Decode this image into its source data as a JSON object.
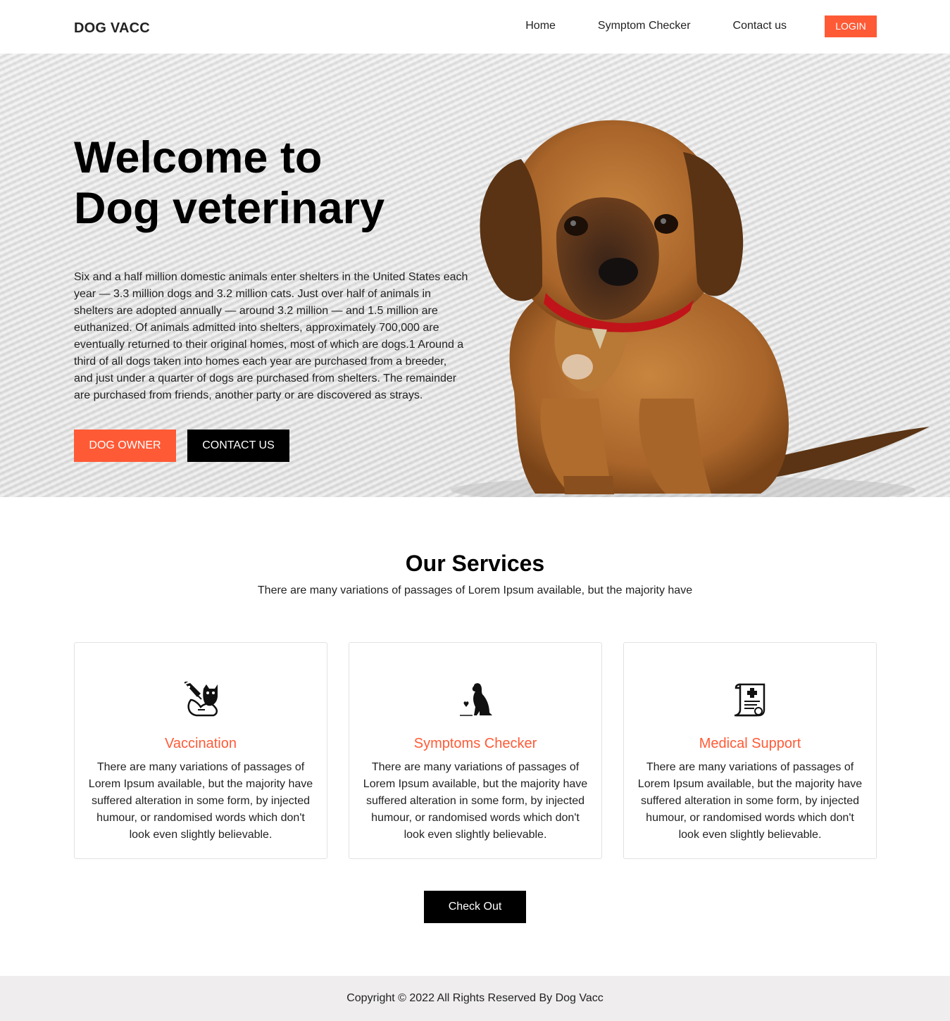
{
  "header": {
    "brand": "DOG VACC",
    "nav": [
      "Home",
      "Symptom Checker",
      "Contact us"
    ],
    "login_label": "LOGIN"
  },
  "hero": {
    "title_line1": "Welcome to",
    "title_line2": "Dog veterinary",
    "text": "Six and a half million domestic animals enter shelters in the United States each year — 3.3 million dogs and 3.2 million cats. Just over half of animals in shelters are adopted annually — around 3.2 million — and 1.5 million are euthanized. Of animals admitted into shelters, approximately 700,000 are eventually returned to their original homes, most of which are dogs.1 Around a third of all dogs taken into homes each year are purchased from a breeder, and just under a quarter of dogs are purchased from shelters. The remainder are purchased from friends, another party or are discovered as strays.",
    "primary_button": "DOG OWNER",
    "secondary_button": "CONTACT US"
  },
  "services": {
    "title": "Our Services",
    "subtitle": "There are many variations of passages of Lorem Ipsum available, but the majority have",
    "cards": [
      {
        "icon": "vaccine-pet-icon",
        "title": "Vaccination",
        "text": "There are many variations of passages of Lorem Ipsum available, but the majority have suffered alteration in some form, by injected humour, or randomised words which don't look even slightly believable."
      },
      {
        "icon": "dog-sitting-icon",
        "title": "Symptoms Checker",
        "text": "There are many variations of passages of Lorem Ipsum available, but the majority have suffered alteration in some form, by injected humour, or randomised words which don't look even slightly believable."
      },
      {
        "icon": "medical-document-icon",
        "title": "Medical Support",
        "text": "There are many variations of passages of Lorem Ipsum available, but the majority have suffered alteration in some form, by injected humour, or randomised words which don't look even slightly believable."
      }
    ],
    "check_button": "Check Out"
  },
  "footer": {
    "copyright": "Copyright © 2022 All Rights Reserved By Dog Vacc"
  },
  "colors": {
    "accent": "#ff5a36",
    "dark": "#000000",
    "footer_bg": "#efeded"
  }
}
